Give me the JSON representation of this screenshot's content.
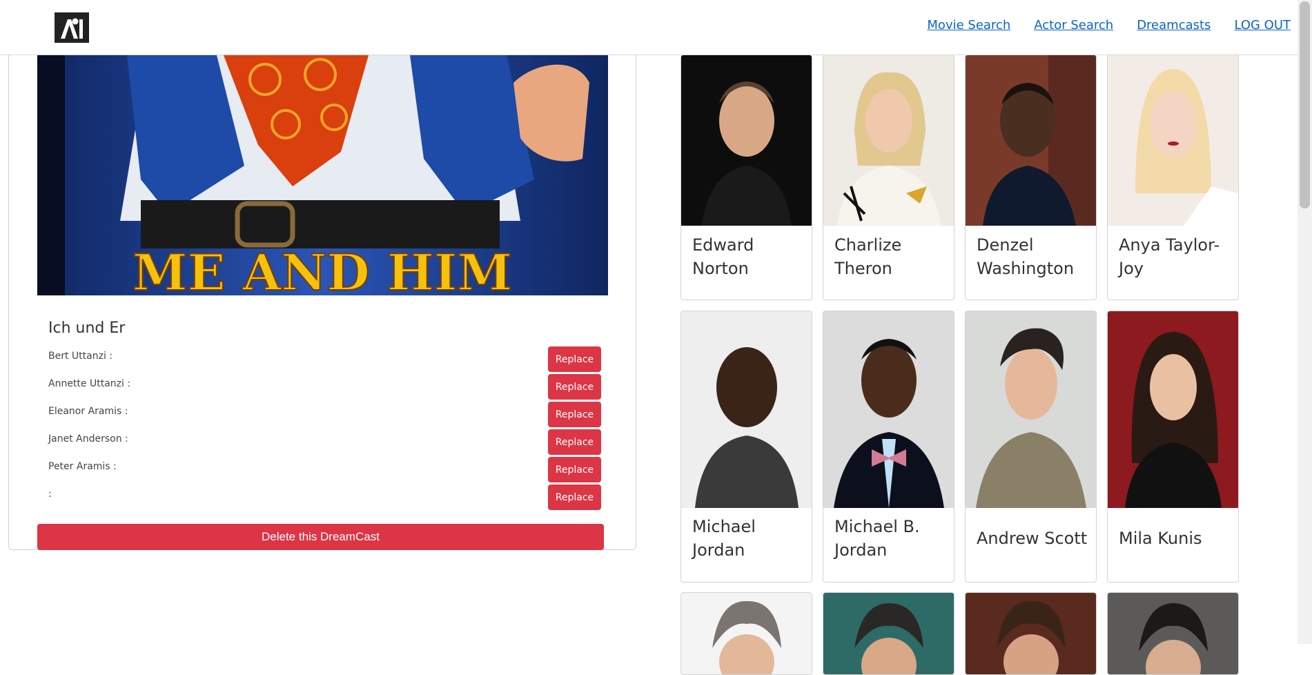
{
  "nav": {
    "logo_alt": "Logo",
    "links": [
      "Movie Search",
      "Actor Search",
      "Dreamcasts",
      "LOG OUT"
    ]
  },
  "dreamcast": {
    "poster_title": "ME AND HIM",
    "movie_title": "Ich und Er",
    "cast": [
      {
        "role": "Bert Uttanzi :",
        "button": "Replace"
      },
      {
        "role": "Annette Uttanzi :",
        "button": "Replace"
      },
      {
        "role": "Eleanor Aramis :",
        "button": "Replace"
      },
      {
        "role": "Janet Anderson :",
        "button": "Replace"
      },
      {
        "role": "Peter Aramis :",
        "button": "Replace"
      },
      {
        "role": ":",
        "button": "Replace"
      }
    ],
    "delete_label": "Delete this DreamCast"
  },
  "actors": [
    {
      "name": "Edward Norton"
    },
    {
      "name": "Charlize Theron"
    },
    {
      "name": "Denzel Washington"
    },
    {
      "name": "Anya Taylor-Joy"
    },
    {
      "name": "Michael Jordan"
    },
    {
      "name": "Michael B. Jordan"
    },
    {
      "name": "Andrew Scott"
    },
    {
      "name": "Mila Kunis"
    }
  ],
  "colors": {
    "danger": "#dc3545",
    "link": "#0b63ce",
    "poster_blue": "#16307a",
    "poster_title": "#f4c20d"
  }
}
